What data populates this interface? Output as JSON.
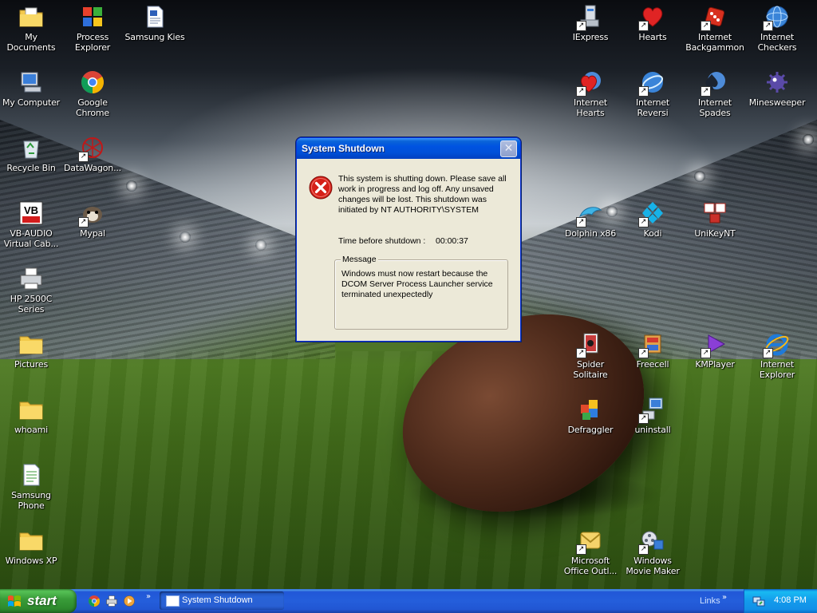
{
  "desktop_icons_left": [
    {
      "id": "my-documents",
      "label": "My Documents",
      "icon": "folder-documents-icon"
    },
    {
      "id": "process-explorer",
      "label": "Process Explorer",
      "icon": "process-explorer-icon"
    },
    {
      "id": "samsung-kies",
      "label": "Samsung Kies",
      "icon": "document-icon"
    },
    {
      "id": "my-computer",
      "label": "My Computer",
      "icon": "computer-icon"
    },
    {
      "id": "google-chrome",
      "label": "Google Chrome",
      "icon": "chrome-icon"
    },
    {
      "id": "recycle-bin",
      "label": "Recycle Bin",
      "icon": "recycle-bin-icon"
    },
    {
      "id": "datawagon",
      "label": "DataWagon...",
      "icon": "datawagon-icon"
    },
    {
      "id": "vb-audio",
      "label": "VB-AUDIO Virtual Cab...",
      "icon": "vb-audio-icon"
    },
    {
      "id": "mypal",
      "label": "Mypal",
      "icon": "mypal-icon"
    },
    {
      "id": "hp-2500c",
      "label": "HP 2500C Series",
      "icon": "printer-icon"
    },
    {
      "id": "pictures",
      "label": "Pictures",
      "icon": "folder-icon"
    },
    {
      "id": "whoami",
      "label": "whoami",
      "icon": "folder-icon"
    },
    {
      "id": "samsung-phone",
      "label": "Samsung Phone",
      "icon": "samsung-phone-icon"
    },
    {
      "id": "windows-xp",
      "label": "Windows XP",
      "icon": "folder-icon"
    }
  ],
  "desktop_icons_right": [
    {
      "id": "iexpress",
      "label": "IExpress",
      "icon": "iexpress-icon"
    },
    {
      "id": "hearts",
      "label": "Hearts",
      "icon": "heart-icon"
    },
    {
      "id": "internet-backgammon",
      "label": "Internet Backgammon",
      "icon": "backgammon-icon"
    },
    {
      "id": "internet-checkers",
      "label": "Internet Checkers",
      "icon": "checkers-icon"
    },
    {
      "id": "internet-hearts",
      "label": "Internet Hearts",
      "icon": "internet-hearts-icon"
    },
    {
      "id": "internet-reversi",
      "label": "Internet Reversi",
      "icon": "reversi-icon"
    },
    {
      "id": "internet-spades",
      "label": "Internet Spades",
      "icon": "spades-icon"
    },
    {
      "id": "minesweeper",
      "label": "Minesweeper",
      "icon": "mine-icon"
    },
    {
      "id": "dolphin",
      "label": "Dolphin x86",
      "icon": "dolphin-icon"
    },
    {
      "id": "kodi",
      "label": "Kodi",
      "icon": "kodi-icon"
    },
    {
      "id": "unikeynt",
      "label": "UniKeyNT",
      "icon": "unikey-icon"
    },
    {
      "id": "spider-solitaire",
      "label": "Spider Solitaire",
      "icon": "spider-solitaire-icon"
    },
    {
      "id": "freecell",
      "label": "Freecell",
      "icon": "freecell-icon"
    },
    {
      "id": "kmplayer",
      "label": "KMPlayer",
      "icon": "kmplayer-icon"
    },
    {
      "id": "internet-explorer",
      "label": "Internet Explorer",
      "icon": "internet-explorer-icon"
    },
    {
      "id": "defraggler",
      "label": "Defraggler",
      "icon": "defraggler-icon"
    },
    {
      "id": "uninstall",
      "label": "uninstall",
      "icon": "uninstall-icon"
    },
    {
      "id": "outlook",
      "label": "Microsoft Office Outl...",
      "icon": "outlook-icon"
    },
    {
      "id": "movie-maker",
      "label": "Windows Movie Maker",
      "icon": "movie-maker-icon"
    }
  ],
  "dialog": {
    "title": "System Shutdown",
    "close_glyph": "✕",
    "icon": "error-icon",
    "message": "This system is shutting down. Please save all work in progress and log off. Any unsaved changes will be lost. This shutdown was initiated by NT AUTHORITY\\SYSTEM",
    "time_label": "Time before shutdown :",
    "time_value": "00:00:37",
    "group_label": "Message",
    "group_message": "Windows must now restart because the DCOM Server Process Launcher service terminated unexpectedly"
  },
  "taskbar": {
    "start_label": "start",
    "quick_launch": [
      "chrome-icon",
      "printer-icon",
      "media-icon"
    ],
    "more_glyph": "»",
    "task_label": "System Shutdown",
    "links_label": "Links",
    "links_glyph": "»",
    "clock": "4:08 PM"
  },
  "colors": {
    "title_bar": "#0053e1",
    "dialog_bg": "#ece9d8",
    "taskbar": "#245edb",
    "start_button": "#3a9d3a",
    "tray": "#139beb"
  }
}
